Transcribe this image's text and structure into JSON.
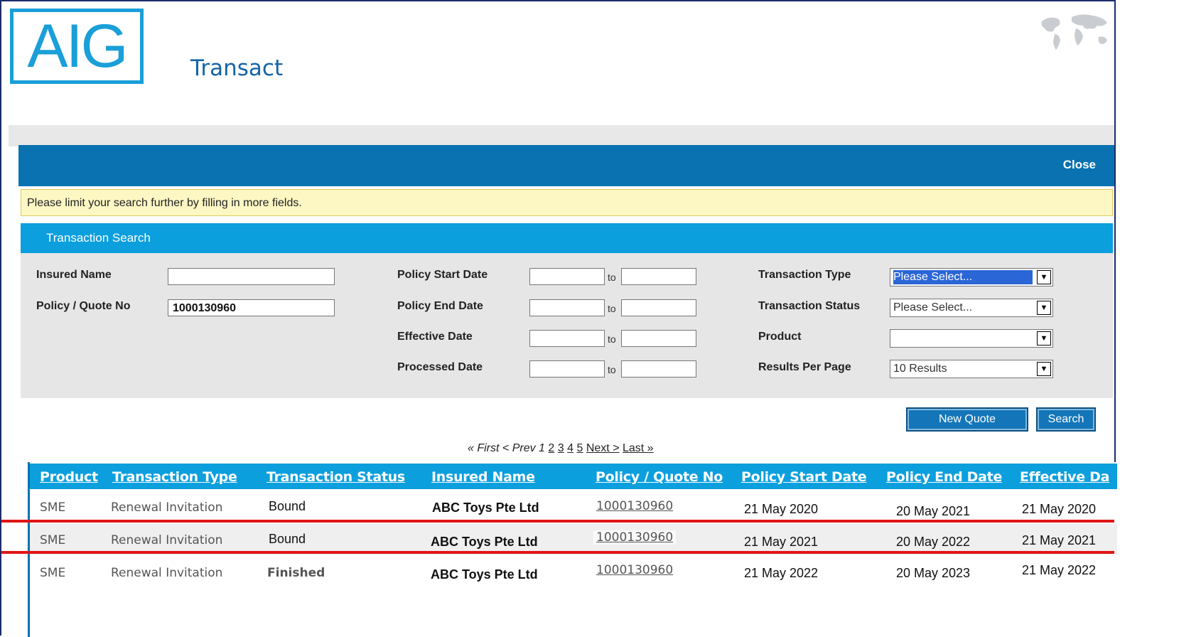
{
  "header": {
    "logo_text": "AIG",
    "app_title": "Transact"
  },
  "bar": {
    "close_label": "Close"
  },
  "notice": {
    "text": "Please limit your search further by filling in more fields."
  },
  "search": {
    "section_title": "Transaction Search",
    "insured_name": {
      "label": "Insured Name",
      "value": ""
    },
    "policy_quote_no": {
      "label": "Policy / Quote No",
      "value": "1000130960"
    },
    "policy_start_date": {
      "label": "Policy Start Date",
      "from": "",
      "to_label": "to",
      "to": ""
    },
    "policy_end_date": {
      "label": "Policy End Date",
      "from": "",
      "to_label": "to",
      "to": ""
    },
    "effective_date": {
      "label": "Effective Date",
      "from": "",
      "to_label": "to",
      "to": ""
    },
    "processed_date": {
      "label": "Processed Date",
      "from": "",
      "to_label": "to",
      "to": ""
    },
    "transaction_type": {
      "label": "Transaction Type",
      "selected": "Please Select..."
    },
    "transaction_status": {
      "label": "Transaction Status",
      "selected": "Please Select..."
    },
    "product": {
      "label": "Product",
      "selected": ""
    },
    "results_per_page": {
      "label": "Results Per Page",
      "selected": "10 Results"
    },
    "new_quote_label": "New Quote",
    "search_label": "Search"
  },
  "pager": {
    "first": "« First",
    "prev": "< Prev",
    "current": "1",
    "pages": [
      "2",
      "3",
      "4",
      "5"
    ],
    "next": "Next >",
    "last": "Last »"
  },
  "table": {
    "headers": [
      "Product",
      "Transaction Type",
      "Transaction Status",
      "Insured Name",
      "Policy / Quote No",
      "Policy Start Date",
      "Policy End Date",
      "Effective Da"
    ],
    "rows": [
      {
        "product": "SME",
        "type": "Renewal Invitation",
        "status": "Bound",
        "insured": "ABC Toys Pte Ltd",
        "policy": "1000130960",
        "start": "21 May 2020",
        "end": "20 May 2021",
        "effective": "21 May 2020"
      },
      {
        "product": "SME",
        "type": "Renewal Invitation",
        "status": "Bound",
        "insured": "ABC Toys Pte Ltd",
        "policy": "1000130960",
        "start": "21 May 2021",
        "end": "20 May 2022",
        "effective": "21 May 2021"
      },
      {
        "product": "SME",
        "type": "Renewal Invitation",
        "status": "Finished",
        "insured": "ABC Toys Pte Ltd",
        "policy": "1000130960",
        "start": "21 May 2022",
        "end": "20 May 2023",
        "effective": "21 May 2022"
      }
    ]
  },
  "colors": {
    "brand_blue": "#1a9fd8",
    "bar_blue": "#0a72b0",
    "header_blue": "#0b9fdd",
    "highlight_red": "#e01616",
    "notice_yellow": "#fdf7c3"
  }
}
